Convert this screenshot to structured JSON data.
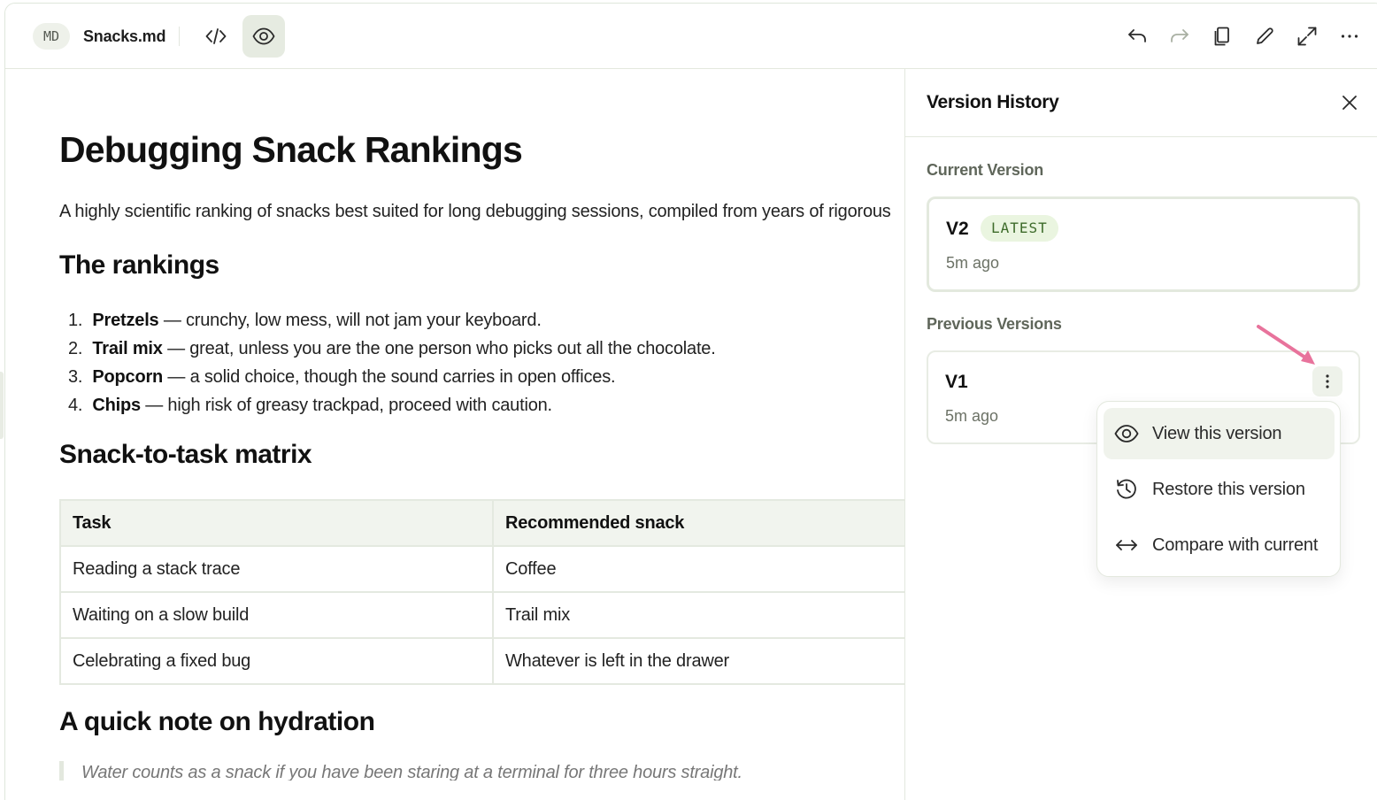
{
  "toolbar": {
    "file_badge": "MD",
    "filename": "Snacks.md",
    "icons": [
      "code-icon",
      "eye-icon",
      "undo-icon",
      "redo-icon",
      "copy-icon",
      "pencil-icon",
      "expand-icon",
      "more-icon"
    ],
    "active_view": "preview"
  },
  "document": {
    "title": "Debugging Snack Rankings",
    "intro": "A highly scientific ranking of snacks best suited for long debugging sessions, compiled from years of rigorous",
    "rankings_heading": "The rankings",
    "rankings": [
      {
        "num": "1.",
        "name": "Pretzels",
        "text": " — crunchy, low mess, will not jam your keyboard."
      },
      {
        "num": "2.",
        "name": "Trail mix",
        "text": " — great, unless you are the one person who picks out all the chocolate."
      },
      {
        "num": "3.",
        "name": "Popcorn",
        "text": " — a solid choice, though the sound carries in open offices."
      },
      {
        "num": "4.",
        "name": "Chips",
        "text": " — high risk of greasy trackpad, proceed with caution."
      }
    ],
    "matrix_heading": "Snack-to-task matrix",
    "matrix": {
      "headers": [
        "Task",
        "Recommended snack"
      ],
      "rows": [
        [
          "Reading a stack trace",
          "Coffee"
        ],
        [
          "Waiting on a slow build",
          "Trail mix"
        ],
        [
          "Celebrating a fixed bug",
          "Whatever is left in the drawer"
        ]
      ]
    },
    "hydration_heading": "A quick note on hydration",
    "quote": "Water counts as a snack if you have been staring at a terminal for three hours straight."
  },
  "panel": {
    "title": "Version History",
    "current_label": "Current Version",
    "previous_label": "Previous Versions",
    "current": {
      "name": "V2",
      "badge": "LATEST",
      "time": "5m ago"
    },
    "previous": [
      {
        "name": "V1",
        "time": "5m ago"
      }
    ]
  },
  "menu": {
    "items": [
      {
        "label": "View this version",
        "icon": "eye-icon"
      },
      {
        "label": "Restore this version",
        "icon": "history-icon"
      },
      {
        "label": "Compare with current",
        "icon": "compare-arrows-icon"
      }
    ]
  },
  "colors": {
    "accent_bg": "#e6ebe1",
    "latest_badge_bg": "#eaf5e0",
    "latest_badge_text": "#3d6b2a",
    "annotation_arrow": "#e8739c"
  }
}
